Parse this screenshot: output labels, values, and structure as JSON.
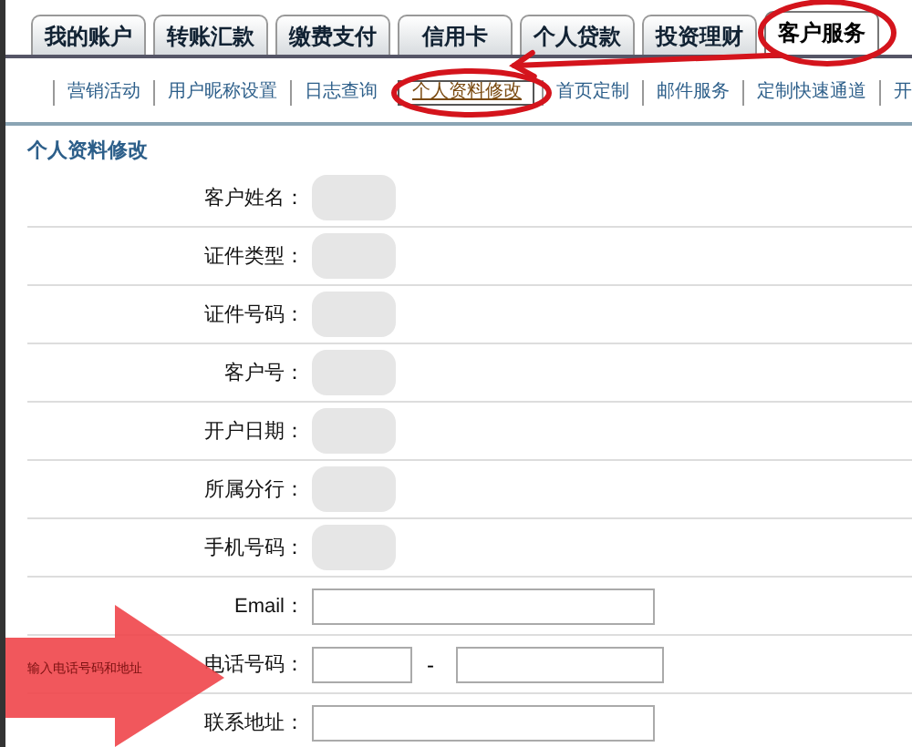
{
  "tabs": [
    {
      "label": "我的账户",
      "selected": false
    },
    {
      "label": "转账汇款",
      "selected": false
    },
    {
      "label": "缴费支付",
      "selected": false
    },
    {
      "label": "信用卡",
      "selected": false
    },
    {
      "label": "个人贷款",
      "selected": false
    },
    {
      "label": "投资理财",
      "selected": false
    },
    {
      "label": "客户服务",
      "selected": true
    }
  ],
  "subnav": [
    {
      "label": "营销活动",
      "selected": false
    },
    {
      "label": "用户昵称设置",
      "selected": false
    },
    {
      "label": "日志查询",
      "selected": false
    },
    {
      "label": "个人资料修改",
      "selected": true
    },
    {
      "label": "首页定制",
      "selected": false
    },
    {
      "label": "邮件服务",
      "selected": false
    },
    {
      "label": "定制快速通道",
      "selected": false
    },
    {
      "label": "开",
      "selected": false
    }
  ],
  "section_title": "个人资料修改",
  "fields": [
    {
      "label": "客户姓名：",
      "kind": "text",
      "redacted": true
    },
    {
      "label": "证件类型：",
      "kind": "text",
      "redacted": true
    },
    {
      "label": "证件号码：",
      "kind": "text",
      "redacted": true
    },
    {
      "label": "客户号：",
      "kind": "text",
      "redacted": true
    },
    {
      "label": "开户日期：",
      "kind": "text",
      "redacted": true
    },
    {
      "label": "所属分行：",
      "kind": "text",
      "redacted": true
    },
    {
      "label": "手机号码：",
      "kind": "text",
      "redacted": true
    },
    {
      "label": "Email：",
      "kind": "input",
      "redacted": false
    },
    {
      "label": "电话号码：",
      "kind": "phone",
      "separator": "-",
      "redacted": false
    },
    {
      "label": "联系地址：",
      "kind": "input",
      "redacted": false
    }
  ],
  "annotation": {
    "note": "输入电话号码和地址"
  }
}
